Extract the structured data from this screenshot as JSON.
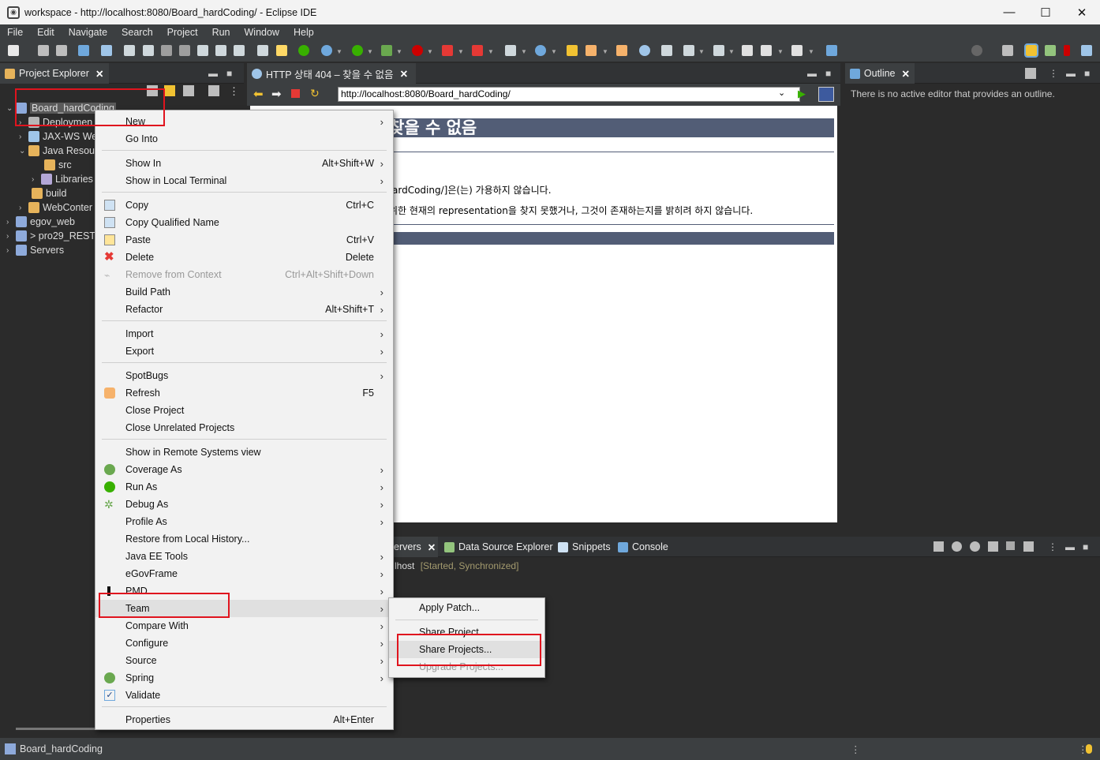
{
  "window": {
    "title": "workspace - http://localhost:8080/Board_hardCoding/ - Eclipse IDE",
    "minimize": "—",
    "maximize": "☐",
    "close": "✕"
  },
  "menubar": [
    "File",
    "Edit",
    "Navigate",
    "Search",
    "Project",
    "Run",
    "Window",
    "Help"
  ],
  "project_explorer": {
    "tab_label": "Project Explorer",
    "tree": [
      {
        "label": "Board_hardCoding",
        "arrow": "⌄"
      },
      {
        "label": "Deploymen",
        "arrow": "›"
      },
      {
        "label": "JAX-WS We",
        "arrow": "›"
      },
      {
        "label": "Java Resour",
        "arrow": "⌄"
      },
      {
        "label": "src",
        "arrow": ""
      },
      {
        "label": "Libraries",
        "arrow": "›"
      },
      {
        "label": "build",
        "arrow": ""
      },
      {
        "label": "WebConter",
        "arrow": "›"
      },
      {
        "label": "egov_web",
        "arrow": "›"
      },
      {
        "label": "> pro29_REST",
        "arrow": "›"
      },
      {
        "label": "Servers",
        "arrow": "›"
      }
    ]
  },
  "browser": {
    "tab_label": "HTTP 상태 404 – 찾을 수 없음",
    "url": "http://localhost:8080/Board_hardCoding/",
    "heading": "찾을 수 없음",
    "line1": "ardCoding/]은(는) 가용하지 않습니다.",
    "line2": "위한 현재의 representation을 찾지 못했거나, 그것이 존재하는지를 밝히려 하지 않습니다."
  },
  "outline": {
    "tab_label": "Outline",
    "message": "There is no active editor that provides an outline."
  },
  "bottom_panel": {
    "tabs": [
      "ervers",
      "Data Source Explorer",
      "Snippets",
      "Console"
    ],
    "server_name": "lhost",
    "server_status": "[Started, Synchronized]"
  },
  "context_menu": {
    "items": [
      {
        "label": "New",
        "shortcut": "",
        "submenu": true
      },
      {
        "label": "Go Into",
        "shortcut": "",
        "submenu": false
      },
      {
        "label": "Show In",
        "shortcut": "Alt+Shift+W",
        "submenu": true
      },
      {
        "label": "Show in Local Terminal",
        "shortcut": "",
        "submenu": true
      },
      {
        "label": "Copy",
        "shortcut": "Ctrl+C",
        "submenu": false
      },
      {
        "label": "Copy Qualified Name",
        "shortcut": "",
        "submenu": false
      },
      {
        "label": "Paste",
        "shortcut": "Ctrl+V",
        "submenu": false
      },
      {
        "label": "Delete",
        "shortcut": "Delete",
        "submenu": false
      },
      {
        "label": "Remove from Context",
        "shortcut": "Ctrl+Alt+Shift+Down",
        "submenu": false,
        "disabled": true
      },
      {
        "label": "Build Path",
        "shortcut": "",
        "submenu": true
      },
      {
        "label": "Refactor",
        "shortcut": "Alt+Shift+T",
        "submenu": true
      },
      {
        "label": "Import",
        "shortcut": "",
        "submenu": true
      },
      {
        "label": "Export",
        "shortcut": "",
        "submenu": true
      },
      {
        "label": "SpotBugs",
        "shortcut": "",
        "submenu": true
      },
      {
        "label": "Refresh",
        "shortcut": "F5",
        "submenu": false
      },
      {
        "label": "Close Project",
        "shortcut": "",
        "submenu": false
      },
      {
        "label": "Close Unrelated Projects",
        "shortcut": "",
        "submenu": false
      },
      {
        "label": "Show in Remote Systems view",
        "shortcut": "",
        "submenu": false
      },
      {
        "label": "Coverage As",
        "shortcut": "",
        "submenu": true
      },
      {
        "label": "Run As",
        "shortcut": "",
        "submenu": true
      },
      {
        "label": "Debug As",
        "shortcut": "",
        "submenu": true
      },
      {
        "label": "Profile As",
        "shortcut": "",
        "submenu": true
      },
      {
        "label": "Restore from Local History...",
        "shortcut": "",
        "submenu": false
      },
      {
        "label": "Java EE Tools",
        "shortcut": "",
        "submenu": true
      },
      {
        "label": "eGovFrame",
        "shortcut": "",
        "submenu": true
      },
      {
        "label": "PMD",
        "shortcut": "",
        "submenu": true
      },
      {
        "label": "Team",
        "shortcut": "",
        "submenu": true,
        "highlighted": true
      },
      {
        "label": "Compare With",
        "shortcut": "",
        "submenu": true
      },
      {
        "label": "Configure",
        "shortcut": "",
        "submenu": true
      },
      {
        "label": "Source",
        "shortcut": "",
        "submenu": true
      },
      {
        "label": "Spring",
        "shortcut": "",
        "submenu": true
      },
      {
        "label": "Validate",
        "shortcut": "",
        "submenu": false
      },
      {
        "label": "Properties",
        "shortcut": "Alt+Enter",
        "submenu": false
      }
    ],
    "submenu_arrow": "›"
  },
  "team_submenu": {
    "items": [
      {
        "label": "Apply Patch..."
      },
      {
        "label": "Share Project"
      },
      {
        "label": "Share Projects...",
        "highlighted": true
      },
      {
        "label": "Upgrade Projects...",
        "disabled": true
      }
    ]
  },
  "statusbar": {
    "text": "Board_hardCoding"
  },
  "colors": {
    "accent_red": "#e0141e",
    "web_heading": "#525d76"
  }
}
